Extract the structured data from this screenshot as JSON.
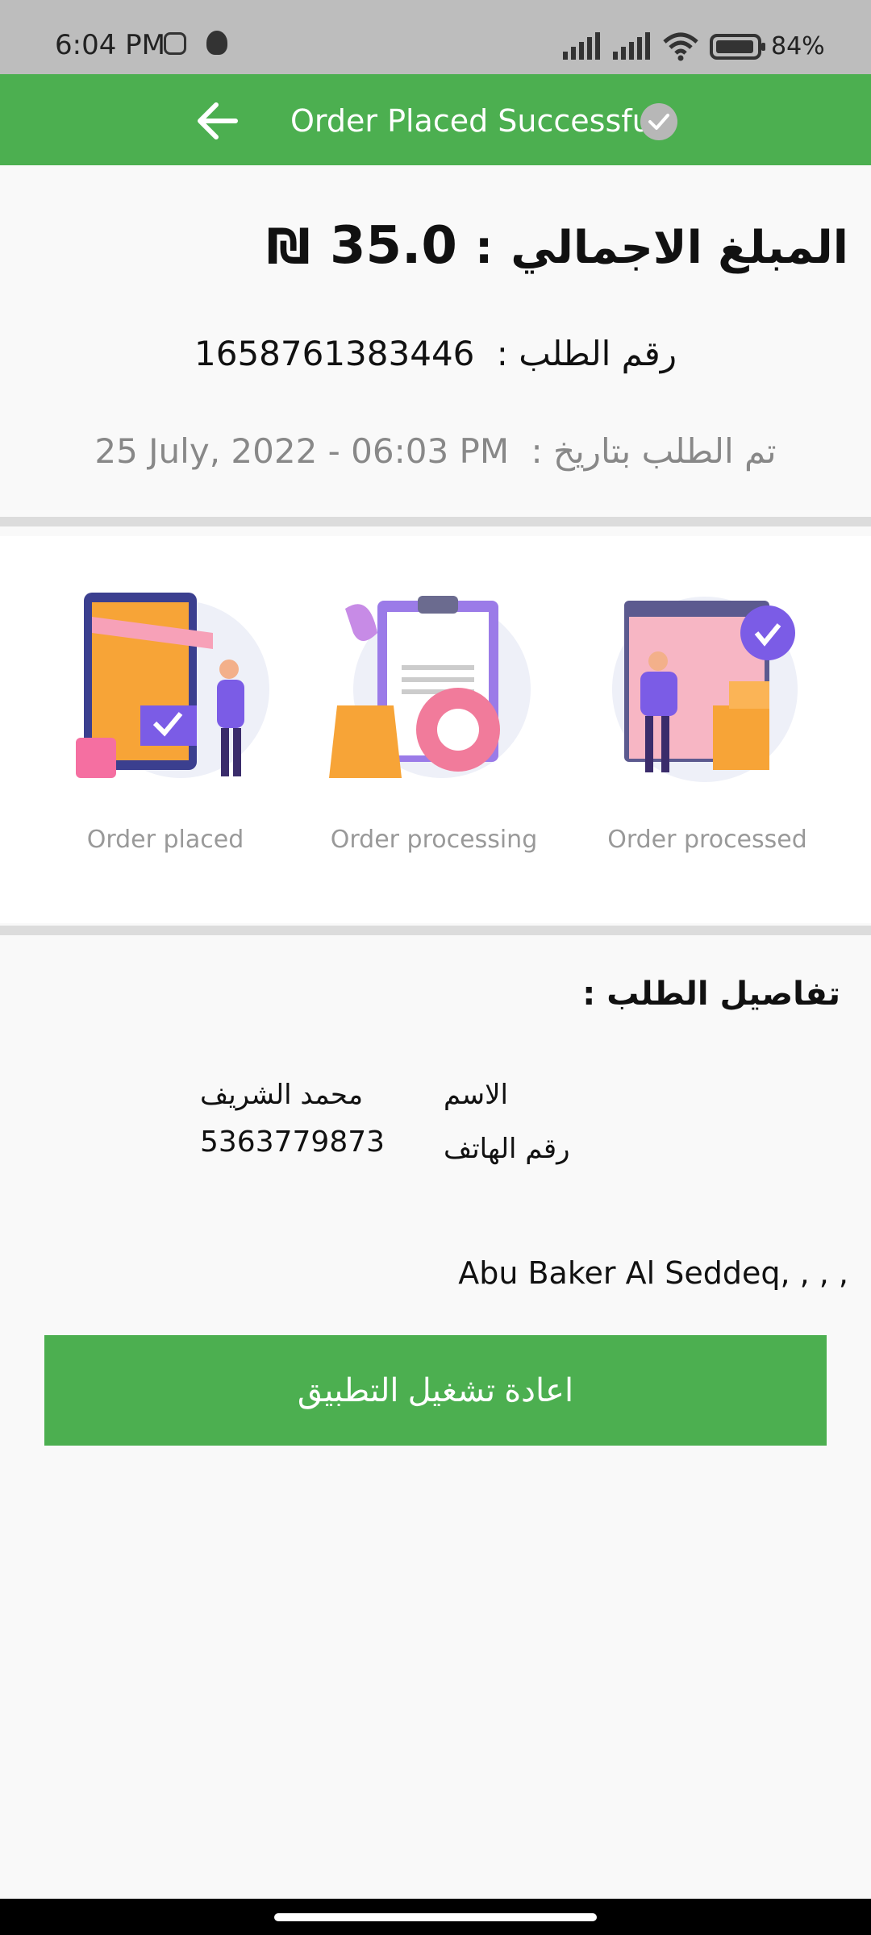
{
  "status_bar": {
    "time": "6:04 PM",
    "battery": "84%"
  },
  "header": {
    "title": "Order Placed Successful"
  },
  "summary": {
    "total_label": "المبلغ الاجمالي",
    "total_sep": ":",
    "total_value": "35.0",
    "currency": "₪",
    "order_number_label": "رقم الطلب :",
    "order_number": "1658761383446",
    "order_date_label": "تم الطلب بتاريخ :",
    "order_date": "25 July, 2022 - 06:03 PM"
  },
  "steps": [
    {
      "label": "Order placed"
    },
    {
      "label": "Order processing"
    },
    {
      "label": "Order processed"
    }
  ],
  "details": {
    "title": "تفاصيل الطلب :",
    "name_label": "الاسم",
    "name_value": "محمد الشريف",
    "phone_label": "رقم الهاتف",
    "phone_value": "5363779873",
    "address": "Abu Baker Al Seddeq,  , , ,"
  },
  "actions": {
    "restart_label": "اعادة تشغيل التطبيق"
  },
  "colors": {
    "accent": "#4caf50",
    "status_bar": "#bdbdbd"
  }
}
